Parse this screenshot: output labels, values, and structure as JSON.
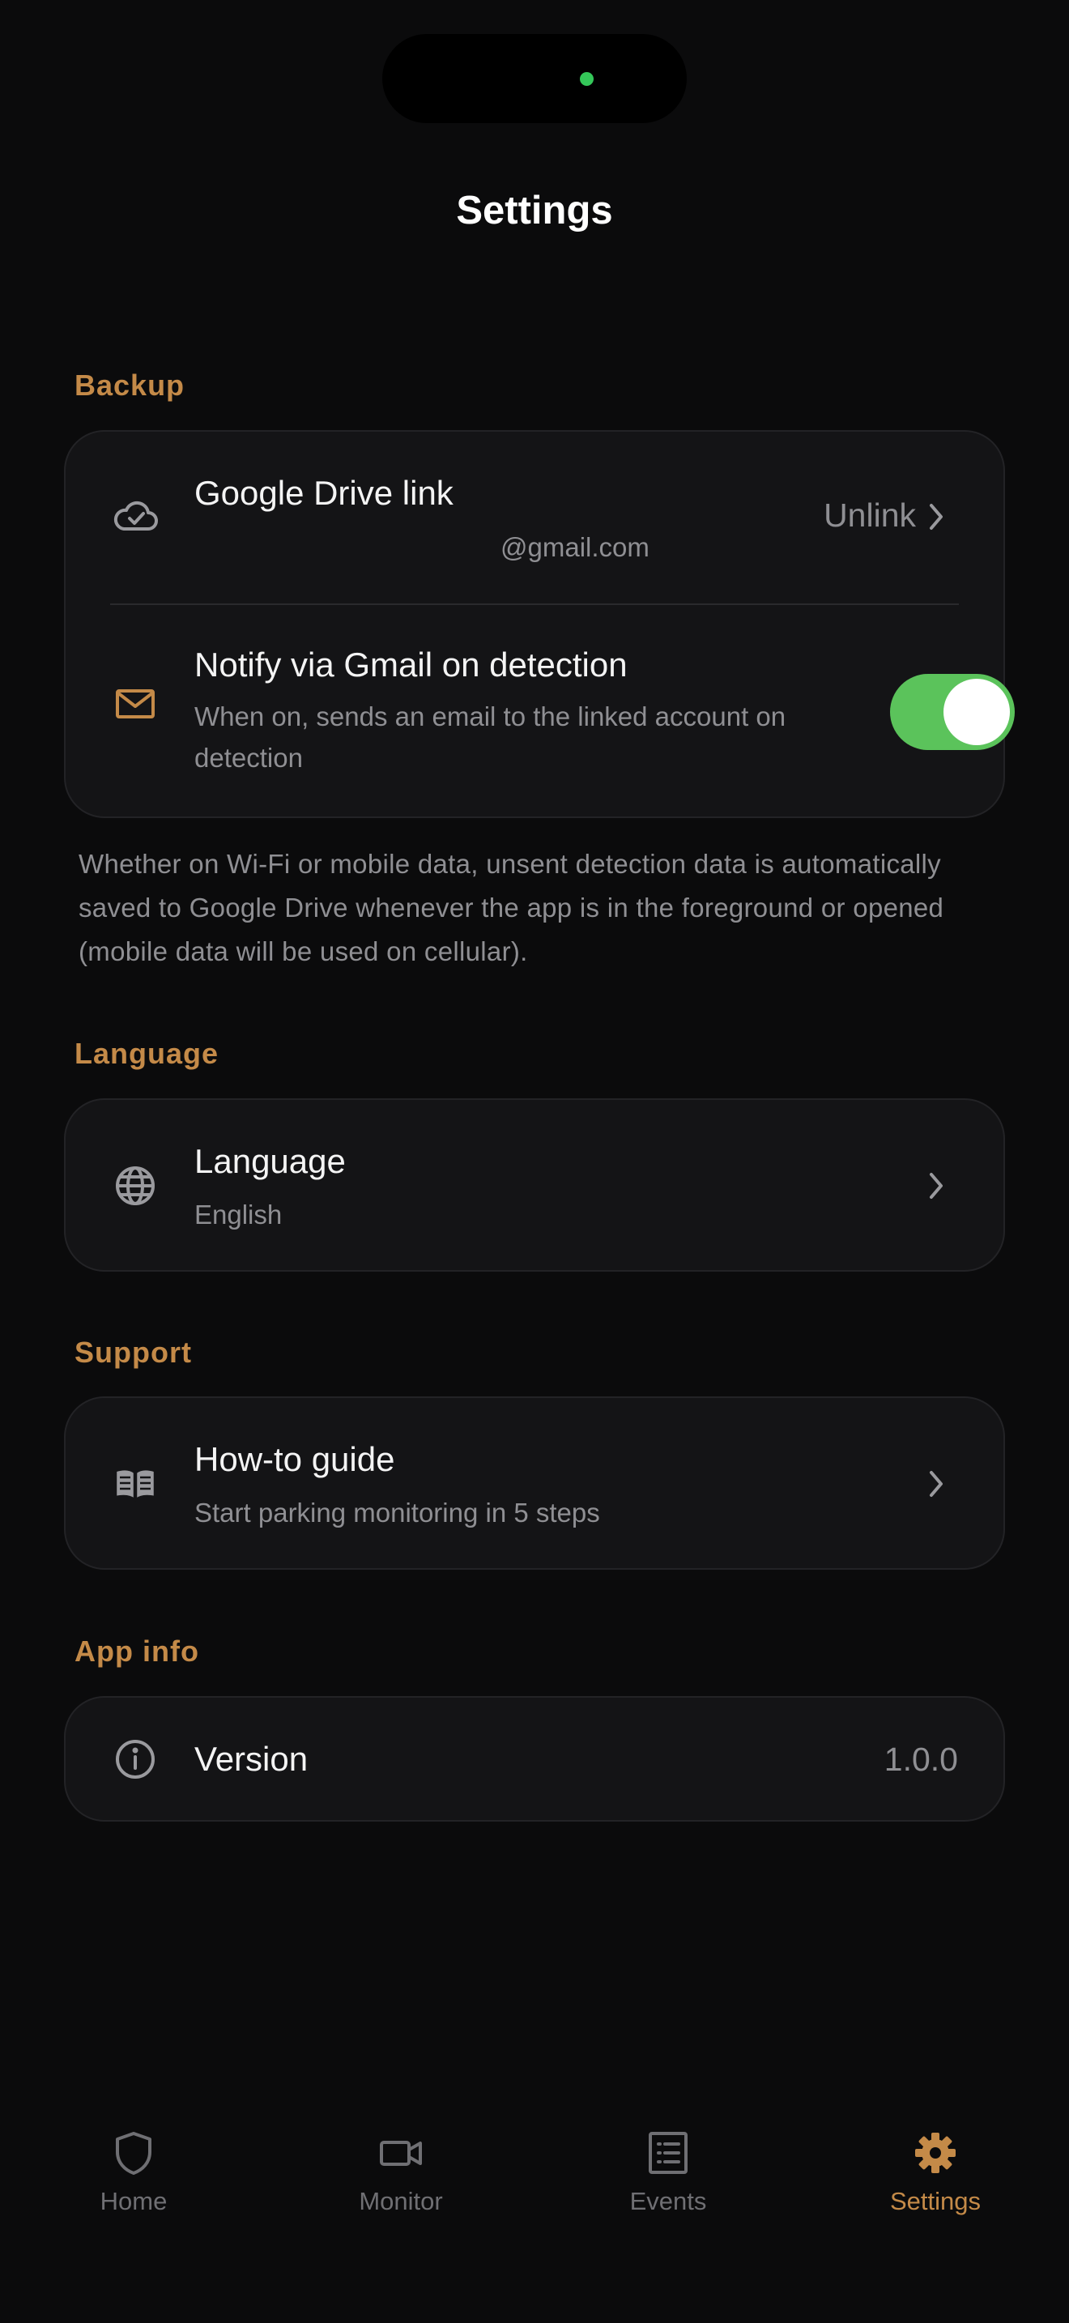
{
  "header": {
    "title": "Settings"
  },
  "sections": {
    "backup": {
      "label": "Backup",
      "drive": {
        "icon": "cloud-check-icon",
        "title": "Google Drive link",
        "account": "@gmail.com",
        "action": "Unlink"
      },
      "notify": {
        "icon": "mail-icon",
        "title": "Notify via Gmail on detection",
        "subtitle": "When on, sends an email to the linked account on detection",
        "enabled": true
      },
      "footnote": "Whether on Wi-Fi or mobile data, unsent detection data is automatically saved to Google Drive whenever the app is in the foreground or opened (mobile data will be used on cellular)."
    },
    "language": {
      "label": "Language",
      "row": {
        "icon": "globe-icon",
        "title": "Language",
        "value": "English"
      }
    },
    "support": {
      "label": "Support",
      "row": {
        "icon": "book-icon",
        "title": "How-to guide",
        "subtitle": "Start parking monitoring in 5 steps"
      }
    },
    "app_info": {
      "label": "App info",
      "row": {
        "icon": "info-icon",
        "title": "Version",
        "value": "1.0.0"
      }
    }
  },
  "tabbar": {
    "items": [
      {
        "label": "Home",
        "icon": "shield-icon",
        "active": false
      },
      {
        "label": "Monitor",
        "icon": "video-camera-icon",
        "active": false
      },
      {
        "label": "Events",
        "icon": "list-icon",
        "active": false
      },
      {
        "label": "Settings",
        "icon": "gear-icon",
        "active": true
      }
    ]
  },
  "colors": {
    "background": "#0b0b0c",
    "card": "#141416",
    "accent": "#c48a48",
    "toggle_on": "#5bc35b",
    "secondary_text": "#8f8f93"
  }
}
